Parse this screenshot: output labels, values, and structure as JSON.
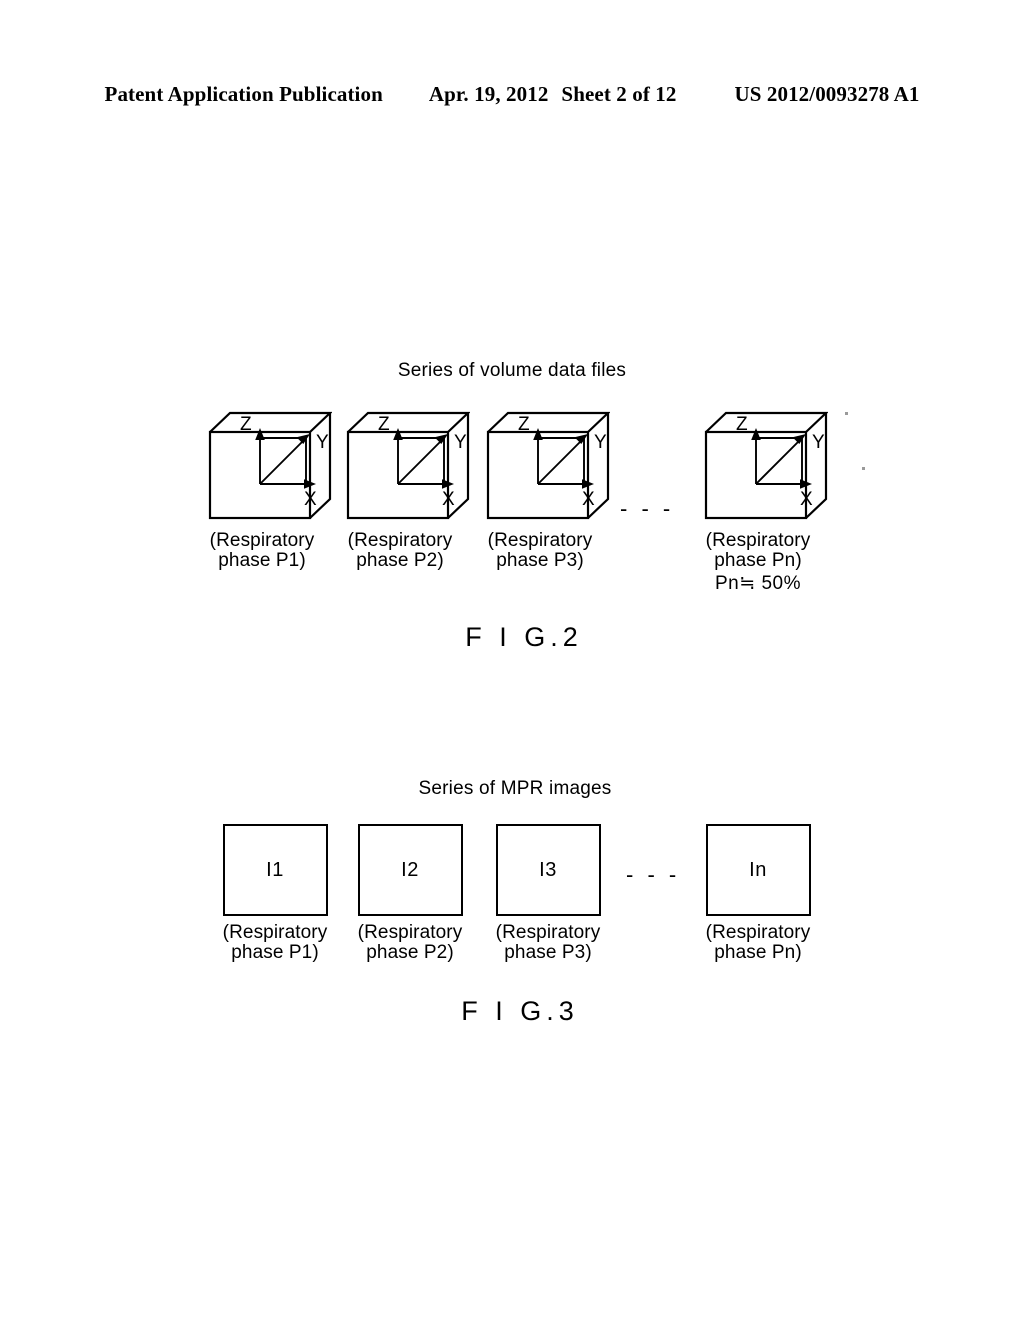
{
  "header": {
    "publication": "Patent Application Publication",
    "date": "Apr. 19, 2012",
    "sheet": "Sheet 2 of 12",
    "doc_number": "US 2012/0093278 A1"
  },
  "figures": [
    {
      "id": "fig2",
      "heading": "Series of volume data files",
      "caption_fig": "F I G.",
      "caption_number": "2",
      "ellipsis": "- - -",
      "axes": {
        "x": "X",
        "y": "Y",
        "z": "Z"
      },
      "items": [
        {
          "type": "cube",
          "caption": "(Respiratory\nphase P1)",
          "note": ""
        },
        {
          "type": "cube",
          "caption": "(Respiratory\nphase P2)",
          "note": ""
        },
        {
          "type": "cube",
          "caption": "(Respiratory\nphase P3)",
          "note": ""
        },
        {
          "type": "cube",
          "caption": "(Respiratory\nphase Pn)",
          "note": "Pn≒ 50%"
        }
      ]
    },
    {
      "id": "fig3",
      "heading": "Series of MPR images",
      "caption_fig": "F I G.",
      "caption_number": "3",
      "ellipsis": "- - -",
      "items": [
        {
          "type": "box",
          "label": "I1",
          "caption": "(Respiratory\nphase P1)"
        },
        {
          "type": "box",
          "label": "I2",
          "caption": "(Respiratory\nphase P2)"
        },
        {
          "type": "box",
          "label": "I3",
          "caption": "(Respiratory\nphase P3)"
        },
        {
          "type": "box",
          "label": "In",
          "caption": "(Respiratory\nphase Pn)"
        }
      ]
    }
  ],
  "colors": {
    "ink": "#000000",
    "paper": "#ffffff"
  }
}
